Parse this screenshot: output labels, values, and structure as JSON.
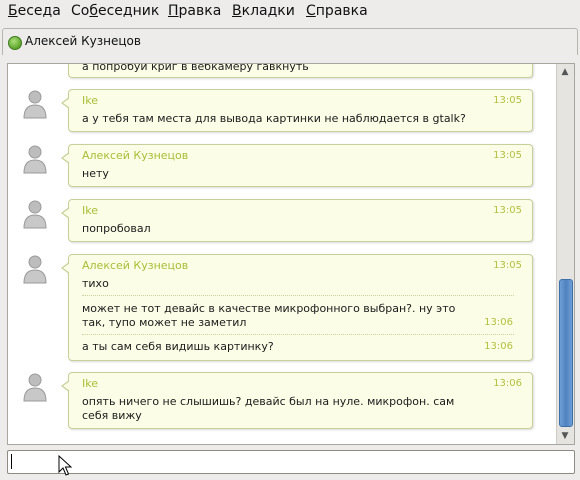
{
  "menubar": {
    "items": [
      {
        "label": "Беседа",
        "u": "Б",
        "rest": "еседа"
      },
      {
        "label": "Собеседник",
        "pre": "Со",
        "u": "б",
        "rest": "еседник"
      },
      {
        "label": "Правка",
        "u": "П",
        "rest": "равка"
      },
      {
        "label": "Вкладки",
        "u": "В",
        "rest": "кладки"
      },
      {
        "label": "Справка",
        "u": "С",
        "rest": "правка"
      }
    ]
  },
  "tab": {
    "contact_name": "Алексей Кузнецов",
    "status_color": "#5fa52c"
  },
  "chat": {
    "partial_top_text": "а попробуй криг в вебкамеру гавкнуть",
    "messages": [
      {
        "sender": "Ike",
        "time": "13:05",
        "text": "а у тебя там места для вывода картинки не наблюдается в gtalk?"
      },
      {
        "sender": "Алексей Кузнецов",
        "time": "13:05",
        "text": "нету"
      },
      {
        "sender": "Ike",
        "time": "13:05",
        "text": "попробовал"
      },
      {
        "sender": "Алексей Кузнецов",
        "time": "13:05",
        "text": "тихо",
        "extra": [
          {
            "time": "13:06",
            "text": "может не тот девайс в качестве микрофонного выбран?. ну это так, тупо может не заметил"
          },
          {
            "time": "13:06",
            "text": "а ты сам себя видишь картинку?"
          }
        ]
      },
      {
        "sender": "Ike",
        "time": "13:06",
        "text": "опять ничего не слышишь? девайс был на нуле. микрофон. сам себя вижу"
      }
    ]
  },
  "input": {
    "value": ""
  },
  "icons": {
    "avatar": "person-silhouette-icon",
    "status": "online-status-icon",
    "pointer": "mouse-pointer-icon",
    "scroll_up": "scroll-up-arrow-icon",
    "scroll_down": "scroll-down-arrow-icon"
  }
}
